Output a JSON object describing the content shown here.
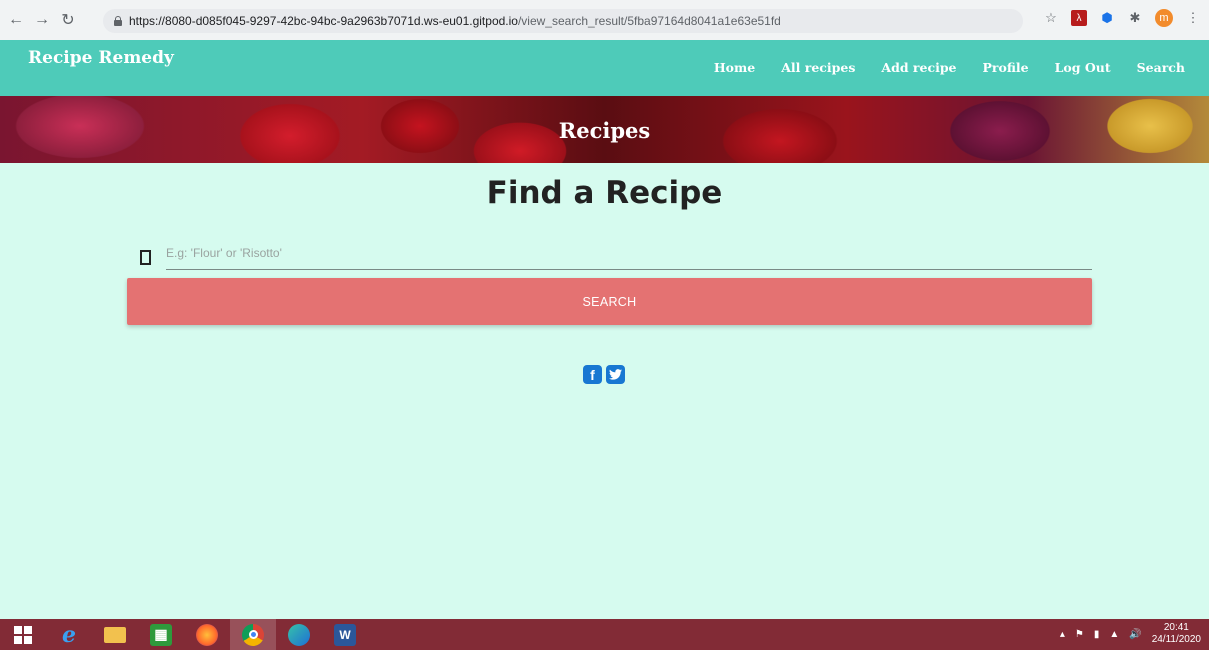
{
  "browser": {
    "url_host": "https://8080-d085f045-9297-42bc-94bc-9a2963b7071d.ws-eu01.gitpod.io",
    "url_path": "/view_search_result/5fba97164d8041a1e63e51fd",
    "avatar_letter": "m"
  },
  "navbar": {
    "brand": "Recipe Remedy",
    "links": [
      "Home",
      "All recipes",
      "Add recipe",
      "Profile",
      "Log Out",
      "Search"
    ]
  },
  "hero": {
    "title": "Recipes"
  },
  "main": {
    "title": "Find a Recipe",
    "search_placeholder": "E.g: 'Flour' or 'Risotto'",
    "search_value": "",
    "search_button": "SEARCH"
  },
  "social": {
    "facebook": "f",
    "twitter": "t"
  },
  "taskbar": {
    "time": "20:41",
    "date": "24/11/2020"
  },
  "colors": {
    "navbar": "#4ecbb9",
    "page_bg": "#d6fbef",
    "search_button": "#e47272",
    "taskbar": "#822b36",
    "social": "#1877d2"
  }
}
